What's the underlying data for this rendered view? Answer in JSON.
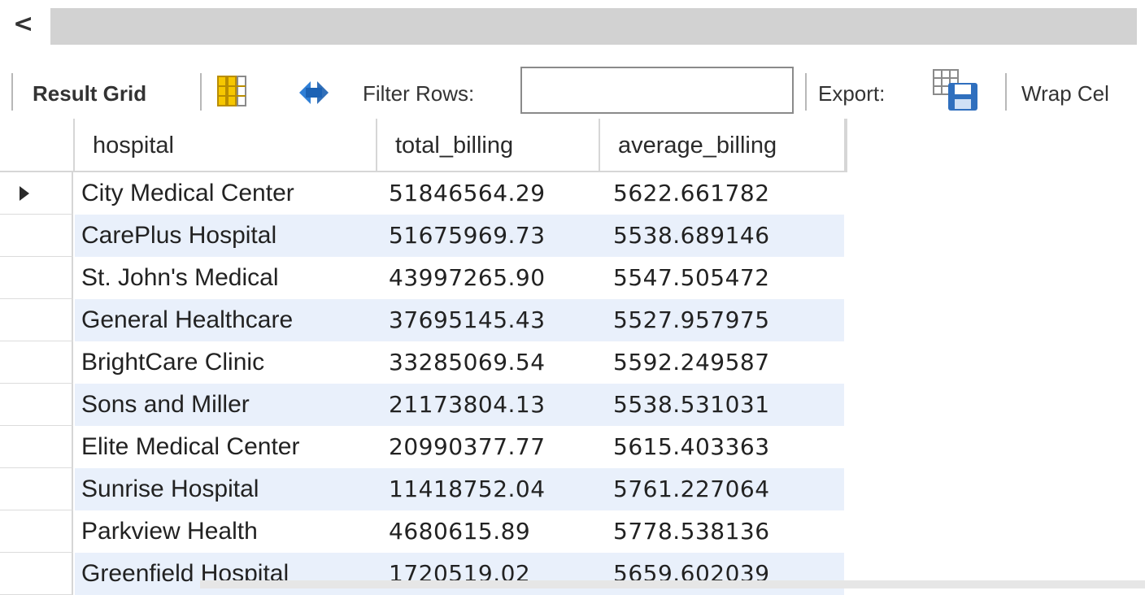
{
  "nav": {
    "back_glyph": "<"
  },
  "toolbar": {
    "result_grid_label": "Result Grid",
    "filter_label": "Filter Rows:",
    "filter_value": "",
    "export_label": "Export:",
    "wrap_label": "Wrap Cel",
    "icons": [
      "grid-columns-icon",
      "refresh-icon",
      "export-icon"
    ]
  },
  "grid": {
    "columns": [
      "hospital",
      "total_billing",
      "average_billing"
    ],
    "rows": [
      {
        "hospital": "City Medical Center",
        "total_billing": "51846564.29",
        "average_billing": "5622.661782"
      },
      {
        "hospital": "CarePlus Hospital",
        "total_billing": "51675969.73",
        "average_billing": "5538.689146"
      },
      {
        "hospital": "St. John's Medical",
        "total_billing": "43997265.90",
        "average_billing": "5547.505472"
      },
      {
        "hospital": "General Healthcare",
        "total_billing": "37695145.43",
        "average_billing": "5527.957975"
      },
      {
        "hospital": "BrightCare Clinic",
        "total_billing": "33285069.54",
        "average_billing": "5592.249587"
      },
      {
        "hospital": "Sons and Miller",
        "total_billing": "21173804.13",
        "average_billing": "5538.531031"
      },
      {
        "hospital": "Elite Medical Center",
        "total_billing": "20990377.77",
        "average_billing": "5615.403363"
      },
      {
        "hospital": "Sunrise Hospital",
        "total_billing": "11418752.04",
        "average_billing": "5761.227064"
      },
      {
        "hospital": "Parkview Health",
        "total_billing": "4680615.89",
        "average_billing": "5778.538136"
      },
      {
        "hospital": "Greenfield Hospital",
        "total_billing": "1720519.02",
        "average_billing": "5659.602039"
      }
    ]
  },
  "colors": {
    "alt_row": "#e9f0fb",
    "accent_blue": "#1f6fd0",
    "icon_yellow": "#f2c100"
  }
}
